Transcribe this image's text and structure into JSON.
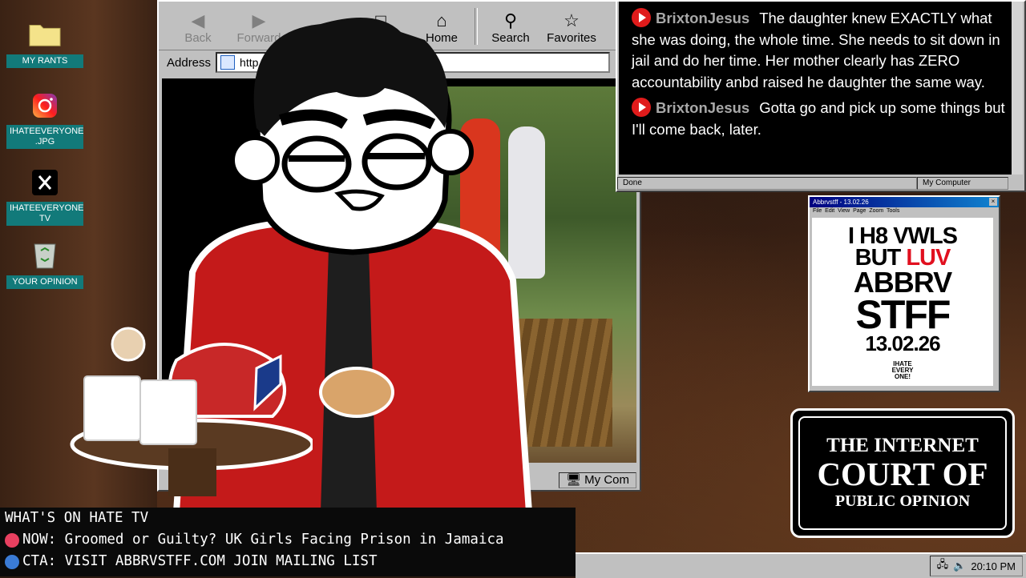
{
  "desktop": {
    "icons": [
      {
        "label": "MY RANTS"
      },
      {
        "label": "IHATEEVERYONE .JPG"
      },
      {
        "label": "IHATEEVERYONE TV"
      },
      {
        "label": "YOUR OPINION"
      }
    ]
  },
  "browser": {
    "toolbar": {
      "back": "Back",
      "forward": "Forward",
      "refresh": "sh",
      "home": "Home",
      "search": "Search",
      "favorites": "Favorites"
    },
    "address_label": "Address",
    "address_value": "http",
    "status_zone": "My Com"
  },
  "chat": {
    "messages": [
      {
        "user": "BrixtonJesus",
        "text": "The daughter knew EXACTLY what she was doing, the whole time. She needs to sit down in jail and do her time. Her mother clearly has ZERO accountability anbd raised he daughter the same way."
      },
      {
        "user": "BrixtonJesus",
        "text": "Gotta go and pick up some things but I'll come back, later."
      }
    ],
    "status_left": "Done",
    "status_right": "My Computer"
  },
  "abbrv": {
    "title": "Abbrvstff - 13.02.26",
    "menu": [
      "File",
      "Edit",
      "View",
      "Page",
      "Zoom",
      "Tools"
    ],
    "line1": "I H8 VWLS",
    "line2_a": "BUT ",
    "line2_b": "LUV",
    "line3": "ABBRV",
    "line4": "STFF",
    "date": "13.02.26",
    "logo": "IHATE EVERY ONE!"
  },
  "court": {
    "line1": "THE INTERNET",
    "line2": "COURT OF",
    "line3": "PUBLIC OPINION"
  },
  "ticker": {
    "heading": "WHAT'S ON HATE TV",
    "now": "NOW: Groomed or Guilty? UK Girls Facing Prison in Jamaica",
    "cta": "CTA: VISIT ABBRVSTFF.COM JOIN MAILING LIST",
    "now_color": "#e84060",
    "cta_color": "#3a7bd5"
  },
  "taskbar": {
    "clock": "20:10 PM"
  }
}
